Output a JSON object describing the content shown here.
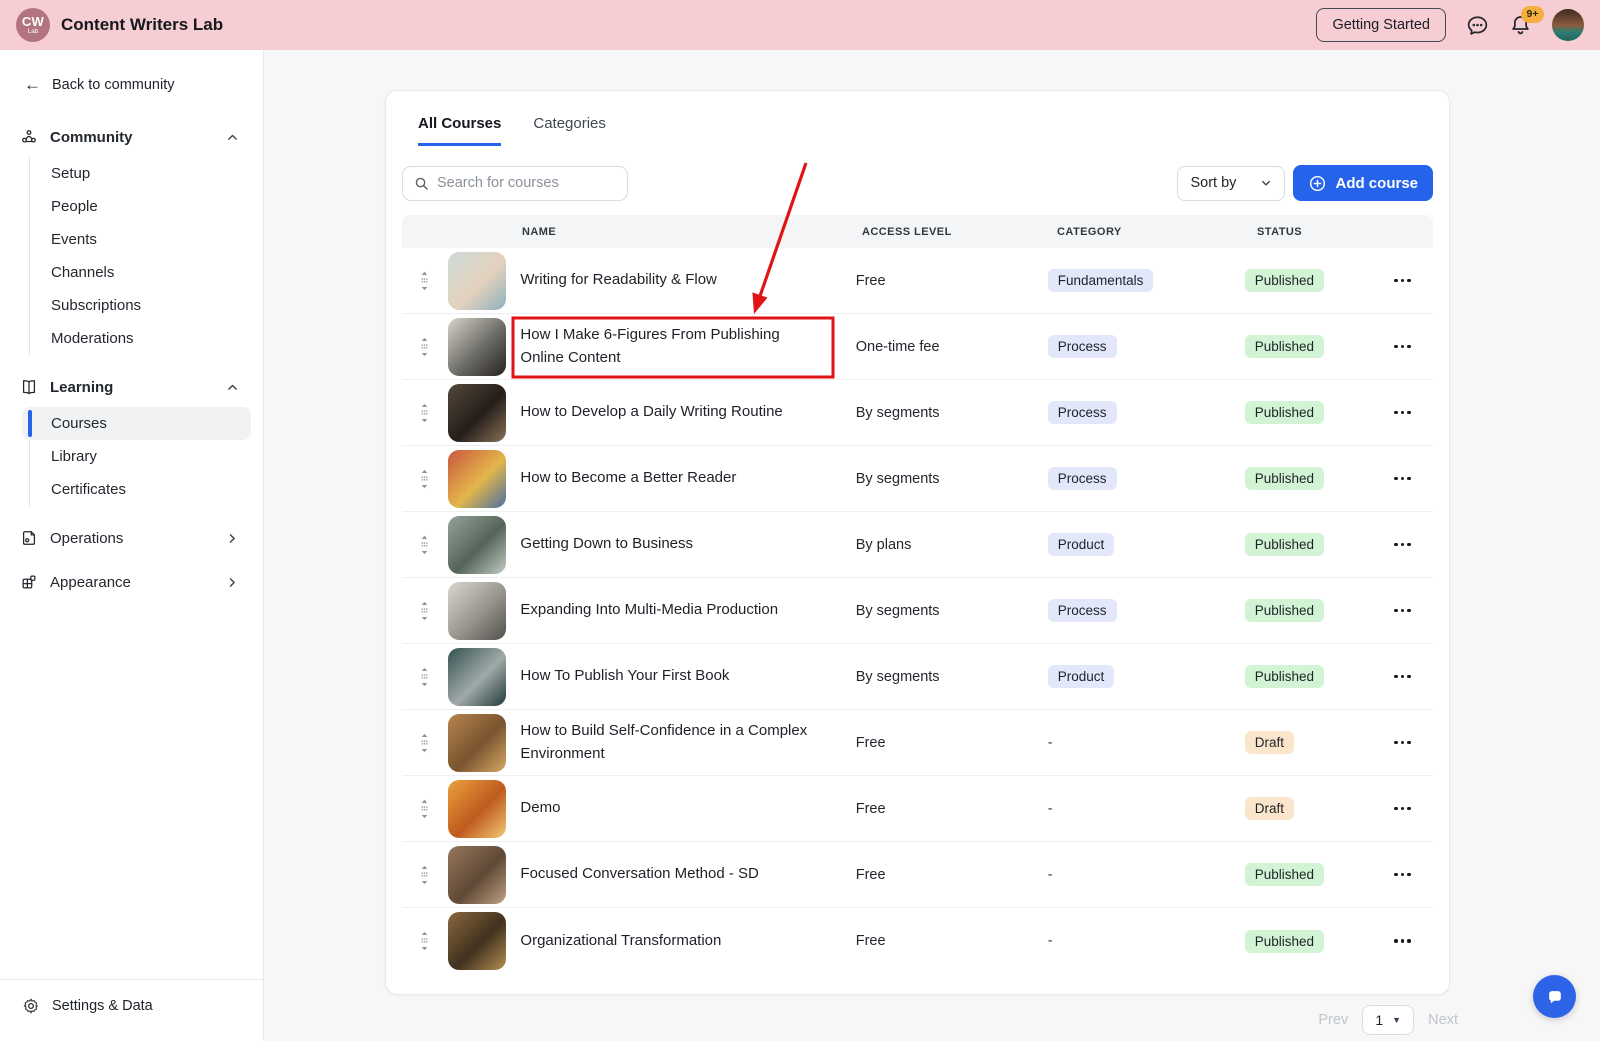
{
  "topbar": {
    "logo_initials": "CW",
    "logo_sub": "Lab",
    "title": "Content Writers Lab",
    "getting_started_label": "Getting Started",
    "notification_count": "9+"
  },
  "sidebar": {
    "back_label": "Back to community",
    "sections": [
      {
        "label": "Community",
        "icon": "community-icon",
        "expanded": true,
        "items": [
          "Setup",
          "People",
          "Events",
          "Channels",
          "Subscriptions",
          "Moderations"
        ]
      },
      {
        "label": "Learning",
        "icon": "learning-icon",
        "expanded": true,
        "items": [
          "Courses",
          "Library",
          "Certificates"
        ],
        "active_item": "Courses"
      },
      {
        "label": "Operations",
        "icon": "operations-icon",
        "expanded": false,
        "items": []
      },
      {
        "label": "Appearance",
        "icon": "appearance-icon",
        "expanded": false,
        "items": []
      }
    ],
    "footer_label": "Settings & Data"
  },
  "main": {
    "tabs": [
      {
        "label": "All Courses",
        "active": true
      },
      {
        "label": "Categories",
        "active": false
      }
    ],
    "search_placeholder": "Search for courses",
    "sort_label": "Sort by",
    "add_course_label": "Add course",
    "table": {
      "columns": [
        "NAME",
        "ACCESS LEVEL",
        "CATEGORY",
        "STATUS"
      ],
      "rows": [
        {
          "name": "Writing for Readability & Flow",
          "access": "Free",
          "category": "Fundamentals",
          "status": "Published",
          "highlighted": false,
          "thumb": [
            "#cdd9d8",
            "#e4d2bd",
            "#8fb0bf"
          ]
        },
        {
          "name": "How I Make 6-Figures From Publishing Online Content",
          "access": "One-time fee",
          "category": "Process",
          "status": "Published",
          "highlighted": true,
          "thumb": [
            "#d9d4c9",
            "#6b6a66",
            "#26221f"
          ]
        },
        {
          "name": "How to Develop a Daily Writing Routine",
          "access": "By segments",
          "category": "Process",
          "status": "Published",
          "highlighted": false,
          "thumb": [
            "#55483c",
            "#241e1a",
            "#8a7258"
          ]
        },
        {
          "name": "How to Become a Better Reader",
          "access": "By segments",
          "category": "Process",
          "status": "Published",
          "highlighted": false,
          "thumb": [
            "#c9573f",
            "#e3b64a",
            "#4a6fa5"
          ]
        },
        {
          "name": "Getting Down to Business",
          "access": "By plans",
          "category": "Product",
          "status": "Published",
          "highlighted": false,
          "thumb": [
            "#93a398",
            "#55645a",
            "#c3cdc4"
          ]
        },
        {
          "name": "Expanding Into Multi-Media Production",
          "access": "By segments",
          "category": "Process",
          "status": "Published",
          "highlighted": false,
          "thumb": [
            "#d8d7d0",
            "#97948c",
            "#51504c"
          ]
        },
        {
          "name": "How To Publish Your First Book",
          "access": "By segments",
          "category": "Product",
          "status": "Published",
          "highlighted": false,
          "thumb": [
            "#355352",
            "#9fa9a8",
            "#233b3a"
          ]
        },
        {
          "name": "How to Build Self-Confidence in a Complex Environment",
          "access": "Free",
          "category": "-",
          "status": "Draft",
          "highlighted": false,
          "thumb": [
            "#b5834f",
            "#7a542f",
            "#d8a963"
          ]
        },
        {
          "name": "Demo",
          "access": "Free",
          "category": "-",
          "status": "Draft",
          "highlighted": false,
          "thumb": [
            "#eba13e",
            "#bf5a1e",
            "#f3c977"
          ]
        },
        {
          "name": "Focused Conversation Method - SD",
          "access": "Free",
          "category": "-",
          "status": "Published",
          "highlighted": false,
          "thumb": [
            "#97765c",
            "#5f4936",
            "#c0a284"
          ]
        },
        {
          "name": "Organizational Transformation",
          "access": "Free",
          "category": "-",
          "status": "Published",
          "highlighted": false,
          "thumb": [
            "#8a683f",
            "#40311f",
            "#b3914f"
          ]
        }
      ]
    },
    "pagination": {
      "prev_label": "Prev",
      "page": "1",
      "next_label": "Next"
    }
  },
  "annotation": {
    "type": "red-box-and-arrow",
    "target_row": "How I Make 6-Figures From Publishing Online Content",
    "color": "#E01414"
  },
  "colors": {
    "accent_blue": "#2563EB",
    "topbar_pink": "#F6CDD2",
    "logo_mauve": "#B2747E",
    "notification_amber": "#F6AE3F",
    "badge_category_bg": "#E3E7FA",
    "badge_published_bg": "#D2F4D4",
    "badge_draft_bg": "#FBE6CC",
    "annotation_red": "#E01414"
  }
}
